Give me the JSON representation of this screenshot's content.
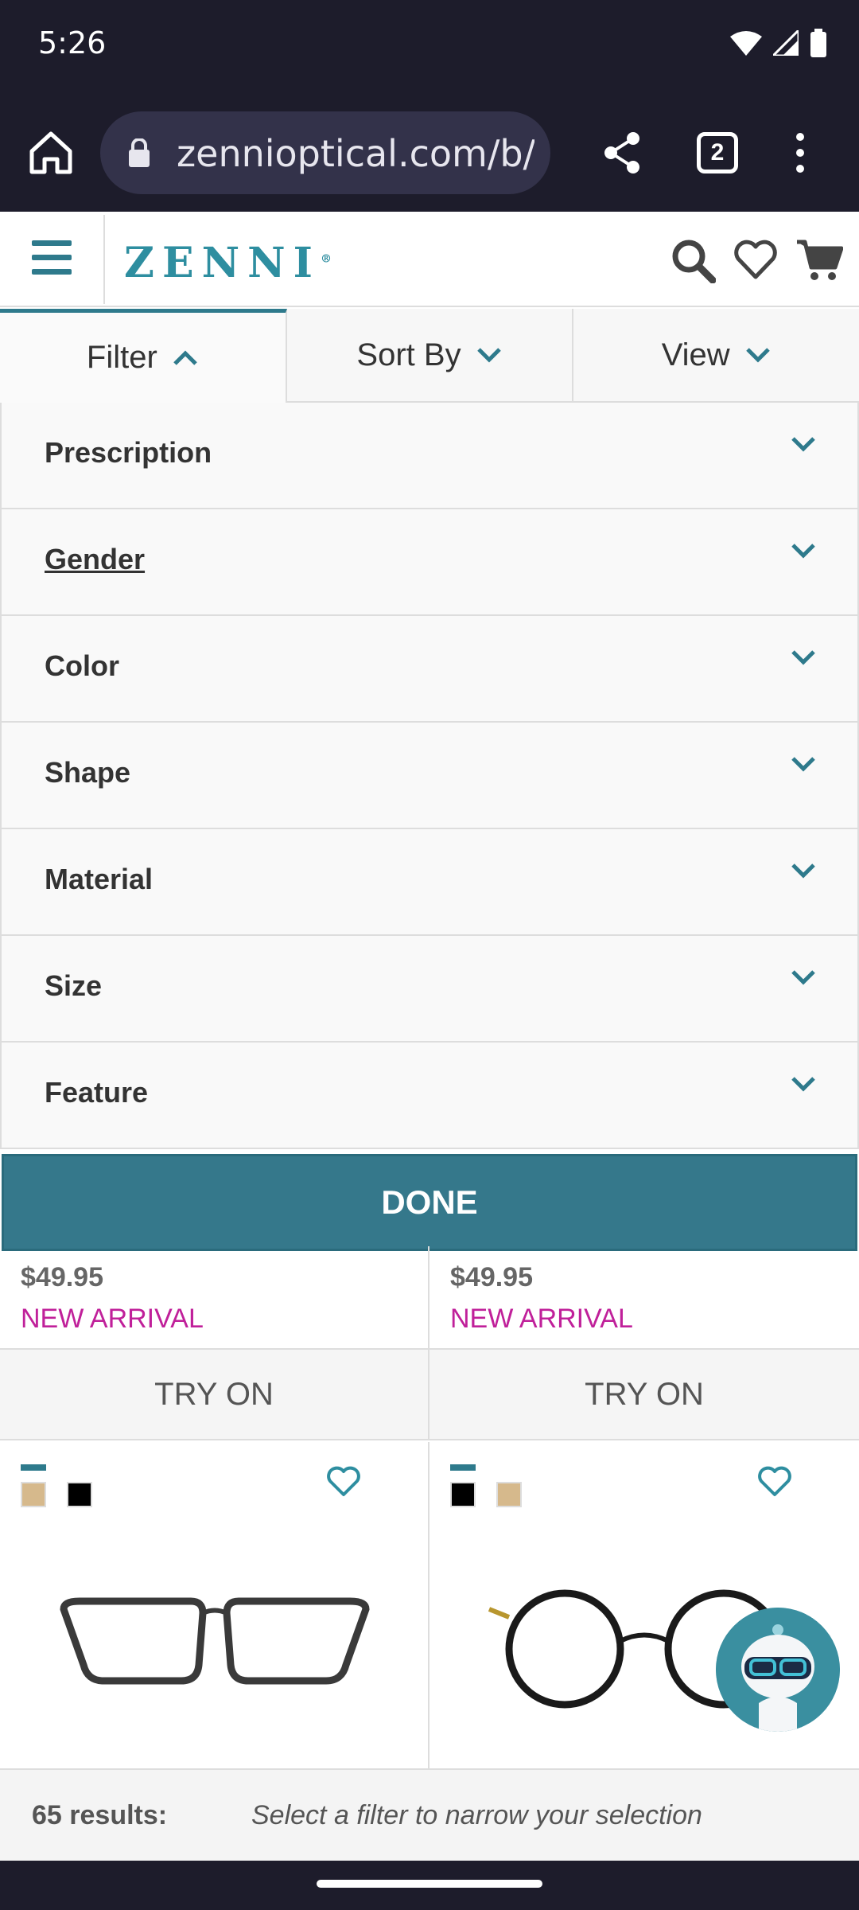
{
  "status_bar": {
    "time": "5:26"
  },
  "browser": {
    "url": "zennioptical.com/b/r",
    "tab_count": "2"
  },
  "header": {
    "logo": "ZENNI"
  },
  "sort_bar": {
    "filter_label": "Filter",
    "sort_label": "Sort By",
    "view_label": "View"
  },
  "filters": [
    {
      "label": "Prescription"
    },
    {
      "label": "Gender"
    },
    {
      "label": "Color"
    },
    {
      "label": "Shape"
    },
    {
      "label": "Material"
    },
    {
      "label": "Size"
    },
    {
      "label": "Feature"
    }
  ],
  "done_label": "DONE",
  "products": [
    {
      "price": "$49.95",
      "badge": "NEW ARRIVAL",
      "try_on": "TRY ON",
      "swatches": [
        "#d6b98c",
        "#000000"
      ]
    },
    {
      "price": "$49.95",
      "badge": "NEW ARRIVAL",
      "try_on": "TRY ON",
      "swatches": [
        "#000000",
        "#d6b98c"
      ]
    }
  ],
  "results": {
    "count": "65 results:",
    "hint": "Select a filter to narrow your selection"
  },
  "colors": {
    "accent": "#35788b",
    "badge": "#c0209a",
    "chrome": "#1d1c2b"
  }
}
